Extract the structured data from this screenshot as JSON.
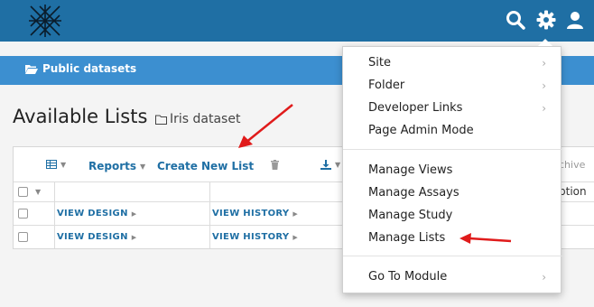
{
  "header": {
    "logo_icon": "cross-hatch-logo-icon",
    "search_icon": "search-icon",
    "settings_icon": "gear-icon",
    "user_icon": "user-icon"
  },
  "nav": {
    "folder_label": "Public datasets",
    "folder_icon": "folder-open-icon"
  },
  "page": {
    "title": "Available Lists",
    "subtitle": "Iris dataset"
  },
  "toolbar": {
    "grid_icon": "grid-icon",
    "reports_label": "Reports",
    "create_label": "Create New List",
    "delete_icon": "trash-icon",
    "export_icon": "download-icon",
    "partial_right_label": "chive"
  },
  "table": {
    "partial_header": "ption",
    "rows": [
      {
        "design": "VIEW DESIGN",
        "history": "VIEW HISTORY"
      },
      {
        "design": "VIEW DESIGN",
        "history": "VIEW HISTORY"
      }
    ]
  },
  "menu": {
    "items": [
      {
        "label": "Site"
      },
      {
        "label": "Folder"
      },
      {
        "label": "Developer Links"
      },
      {
        "label": "Page Admin Mode"
      },
      {
        "label": "Manage Views"
      },
      {
        "label": "Manage Assays"
      },
      {
        "label": "Manage Study"
      },
      {
        "label": "Manage Lists"
      },
      {
        "label": "Go To Module"
      }
    ]
  },
  "colors": {
    "header_blue": "#1f6fa4",
    "bar_blue": "#3c8fd0",
    "arrow_red": "#e01b1b"
  }
}
